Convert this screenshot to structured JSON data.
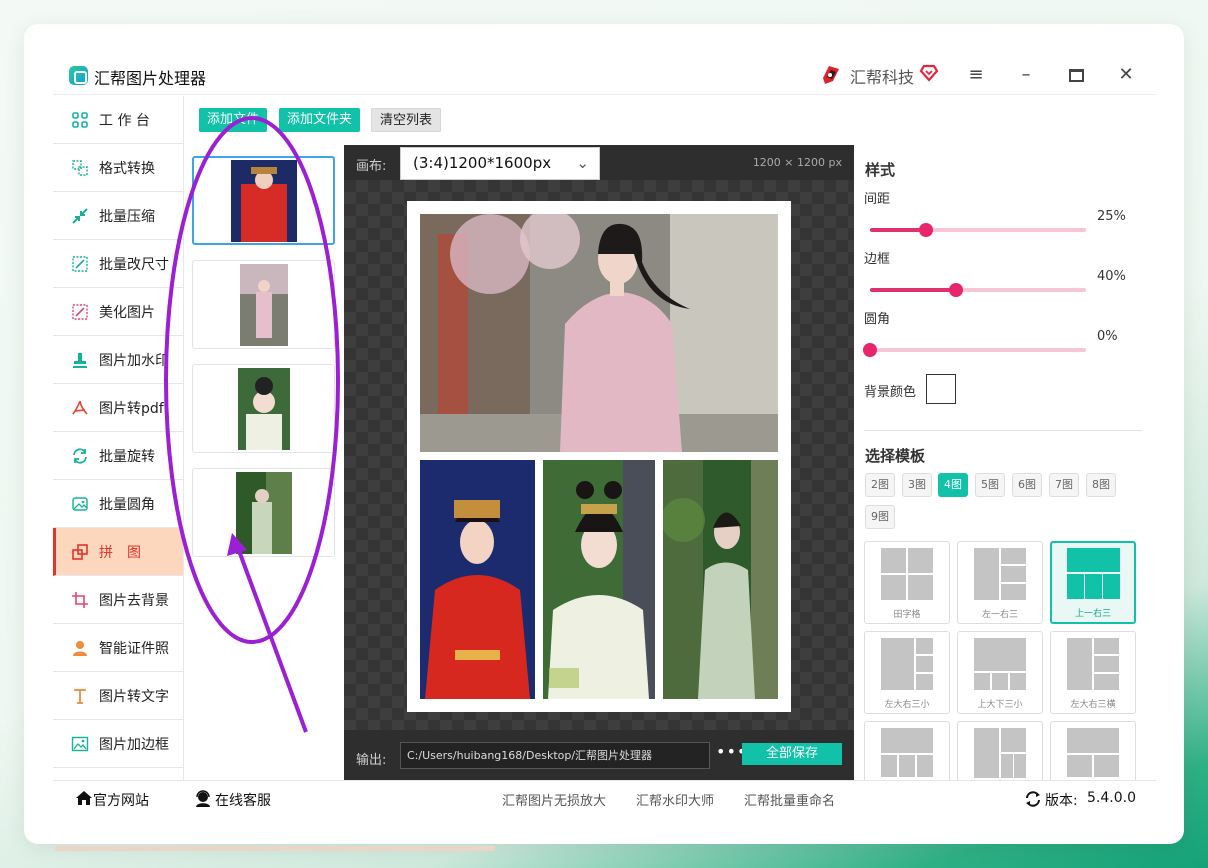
{
  "app": {
    "title": "汇帮图片处理器",
    "brand": "汇帮科技"
  },
  "sidebar": {
    "items": [
      {
        "label": "工 作 台",
        "icon": "grid-icon"
      },
      {
        "label": "格式转换",
        "icon": "convert-icon"
      },
      {
        "label": "批量压缩",
        "icon": "compress-icon"
      },
      {
        "label": "批量改尺寸",
        "icon": "resize-icon"
      },
      {
        "label": "美化图片",
        "icon": "beautify-icon"
      },
      {
        "label": "图片加水印",
        "icon": "watermark-icon"
      },
      {
        "label": "图片转pdf",
        "icon": "pdf-icon"
      },
      {
        "label": "批量旋转",
        "icon": "rotate-icon"
      },
      {
        "label": "批量圆角",
        "icon": "round-corner-icon"
      },
      {
        "label": "拼　图",
        "icon": "puzzle-icon",
        "active": true
      },
      {
        "label": "图片去背景",
        "icon": "crop-icon"
      },
      {
        "label": "智能证件照",
        "icon": "person-icon"
      },
      {
        "label": "图片转文字",
        "icon": "text-icon"
      },
      {
        "label": "图片加边框",
        "icon": "frame-icon"
      }
    ]
  },
  "toolbar": {
    "add_file": "添加文件",
    "add_folder": "添加文件夹",
    "clear_list": "清空列表"
  },
  "canvas": {
    "label": "画布:",
    "size": "(3:4)1200*1600px",
    "dimensions": "1200 × 1200 px"
  },
  "output": {
    "label": "输出:",
    "path": "C:/Users/huibang168/Desktop/汇帮图片处理器",
    "more": "•••",
    "save_all": "全部保存"
  },
  "style": {
    "title": "样式",
    "spacing_label": "间距",
    "spacing_value": "25%",
    "spacing_fraction": 0.26,
    "border_label": "边框",
    "border_value": "40%",
    "border_fraction": 0.4,
    "radius_label": "圆角",
    "radius_value": "0%",
    "radius_fraction": 0.0,
    "bg_label": "背景颜色",
    "bg_color": "#ffffff"
  },
  "templates": {
    "title": "选择模板",
    "counts": [
      "2图",
      "3图",
      "4图",
      "5图",
      "6图",
      "7图",
      "8图",
      "9图"
    ],
    "active_count": "4图",
    "items": [
      "田字格",
      "左一右三",
      "上一右三",
      "左大右三小",
      "上大下三小",
      "左大右三横"
    ],
    "active_item": "上一右三"
  },
  "footer": {
    "site": "官方网站",
    "support": "在线客服",
    "link1": "汇帮图片无损放大",
    "link2": "汇帮水印大师",
    "link3": "汇帮批量重命名",
    "version_label": "版本:",
    "version": "5.4.0.0"
  },
  "colors": {
    "accent": "#12c2a8",
    "active_nav": "#e0352b",
    "slider": "#e8246c",
    "annotation": "#9b1fd4"
  }
}
